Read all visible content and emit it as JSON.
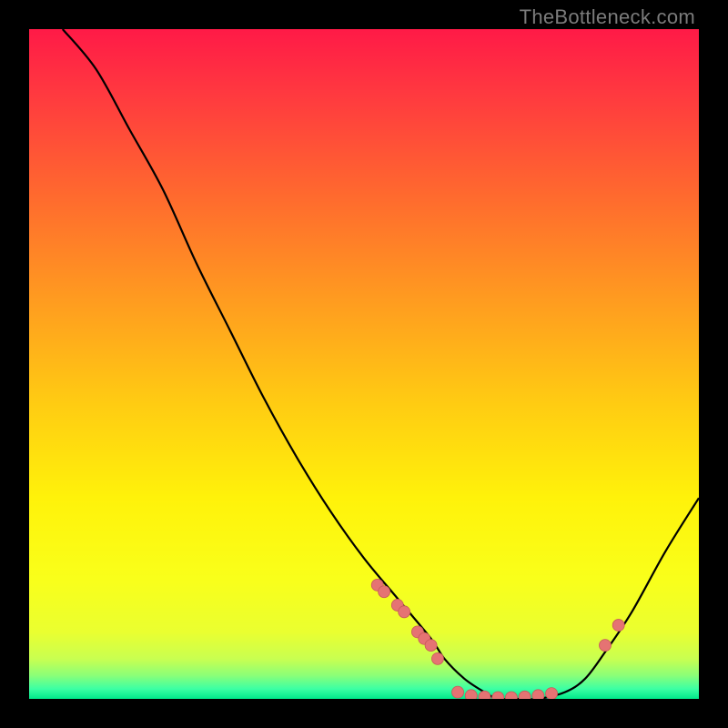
{
  "watermark": "TheBottleneck.com",
  "chart_data": {
    "type": "line",
    "title": "",
    "xlabel": "",
    "ylabel": "",
    "xlim": [
      0,
      100
    ],
    "ylim": [
      0,
      100
    ],
    "grid": false,
    "series": [
      {
        "name": "curve",
        "x": [
          5,
          10,
          15,
          20,
          25,
          30,
          35,
          40,
          45,
          50,
          55,
          60,
          62,
          65,
          68,
          70,
          73,
          76,
          80,
          83,
          86,
          90,
          95,
          100
        ],
        "y": [
          100,
          94,
          85,
          76,
          65,
          55,
          45,
          36,
          28,
          21,
          15,
          9,
          6,
          3,
          1,
          0,
          0,
          0,
          1,
          3,
          7,
          13,
          22,
          30
        ]
      }
    ],
    "markers": [
      {
        "x": 52,
        "y": 17
      },
      {
        "x": 53,
        "y": 16
      },
      {
        "x": 55,
        "y": 14
      },
      {
        "x": 56,
        "y": 13
      },
      {
        "x": 58,
        "y": 10
      },
      {
        "x": 59,
        "y": 9
      },
      {
        "x": 60,
        "y": 8
      },
      {
        "x": 61,
        "y": 6
      },
      {
        "x": 64,
        "y": 1
      },
      {
        "x": 66,
        "y": 0.5
      },
      {
        "x": 68,
        "y": 0.3
      },
      {
        "x": 70,
        "y": 0.2
      },
      {
        "x": 72,
        "y": 0.2
      },
      {
        "x": 74,
        "y": 0.3
      },
      {
        "x": 76,
        "y": 0.5
      },
      {
        "x": 78,
        "y": 0.8
      },
      {
        "x": 86,
        "y": 8
      },
      {
        "x": 88,
        "y": 11
      }
    ],
    "gradient_stops": [
      {
        "offset": 0.0,
        "color": "#ff1a47"
      },
      {
        "offset": 0.1,
        "color": "#ff3a3f"
      },
      {
        "offset": 0.25,
        "color": "#ff6a2e"
      },
      {
        "offset": 0.4,
        "color": "#ff9a20"
      },
      {
        "offset": 0.55,
        "color": "#ffc913"
      },
      {
        "offset": 0.7,
        "color": "#fff20a"
      },
      {
        "offset": 0.82,
        "color": "#f9ff1a"
      },
      {
        "offset": 0.9,
        "color": "#eaff30"
      },
      {
        "offset": 0.94,
        "color": "#c9ff50"
      },
      {
        "offset": 0.965,
        "color": "#8bff78"
      },
      {
        "offset": 0.985,
        "color": "#3cffa4"
      },
      {
        "offset": 1.0,
        "color": "#00e88a"
      }
    ],
    "colors": {
      "curve": "#000000",
      "marker_fill": "#e57373",
      "marker_stroke": "#c85a5a",
      "background": "#000000"
    }
  }
}
